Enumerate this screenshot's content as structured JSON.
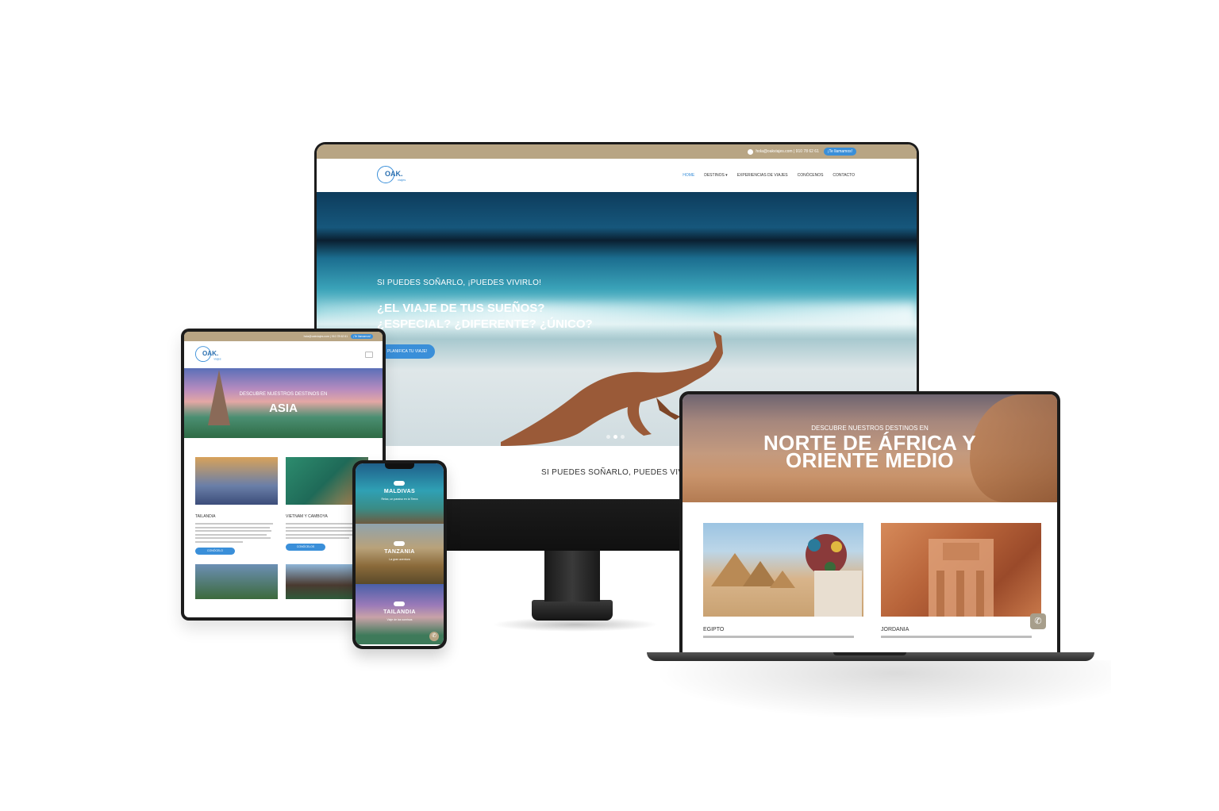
{
  "desktop": {
    "topbar": {
      "contact": "hola@oakviajes.com | 910 78 62 61",
      "call_button": "¡Te llamamos!"
    },
    "logo": {
      "text": "OAK.",
      "sub": "viajes"
    },
    "menu": [
      "HOME",
      "DESTINOS ▾",
      "EXPERIENCIAS DE VIAJES",
      "CONÓCENOS",
      "CONTACTO"
    ],
    "hero": {
      "kicker": "SI PUEDES SOÑARLO, ¡PUEDES VIVIRLO!",
      "headline_line1": "¿EL VIAJE DE TUS SUEÑOS?",
      "headline_line2": "¿ESPECIAL? ¿DIFERENTE? ¿ÚNICO?",
      "cta": "PLANIFICA TU VIAJE!"
    },
    "tagline": "SI PUEDES SOÑARLO, PUEDES VIVIR"
  },
  "tablet": {
    "topbar": {
      "contact": "hola@oakviajes.com | 910 78 62 61",
      "call_button": "¡Te llamamos!"
    },
    "logo": {
      "text": "OAK.",
      "sub": "viajes"
    },
    "hero": {
      "kicker": "DESCUBRE NUESTROS DESTINOS EN",
      "title": "ASIA"
    },
    "cards": [
      {
        "name": "TAILANDIA",
        "button": "CONÓCELO"
      },
      {
        "name": "VIETNAM Y CAMBOYA",
        "button": "CONÓCELOS"
      }
    ]
  },
  "phone": {
    "tiles": [
      {
        "title": "MALDIVAS",
        "sub": "Relax, un paraíso en la Tierra"
      },
      {
        "title": "TANZANIA",
        "sub": "La gran aventura"
      },
      {
        "title": "TAILANDIA",
        "sub": "Viaje de las sonrisas"
      }
    ]
  },
  "laptop": {
    "hero": {
      "kicker": "DESCUBRE NUESTROS DESTINOS EN",
      "title_line1": "NORTE DE ÁFRICA Y",
      "title_line2": "ORIENTE MEDIO"
    },
    "cards": [
      {
        "name": "EGIPTO"
      },
      {
        "name": "JORDANIA"
      }
    ]
  },
  "colors": {
    "accent": "#3a8fd9",
    "topbar": "#b8a584"
  }
}
